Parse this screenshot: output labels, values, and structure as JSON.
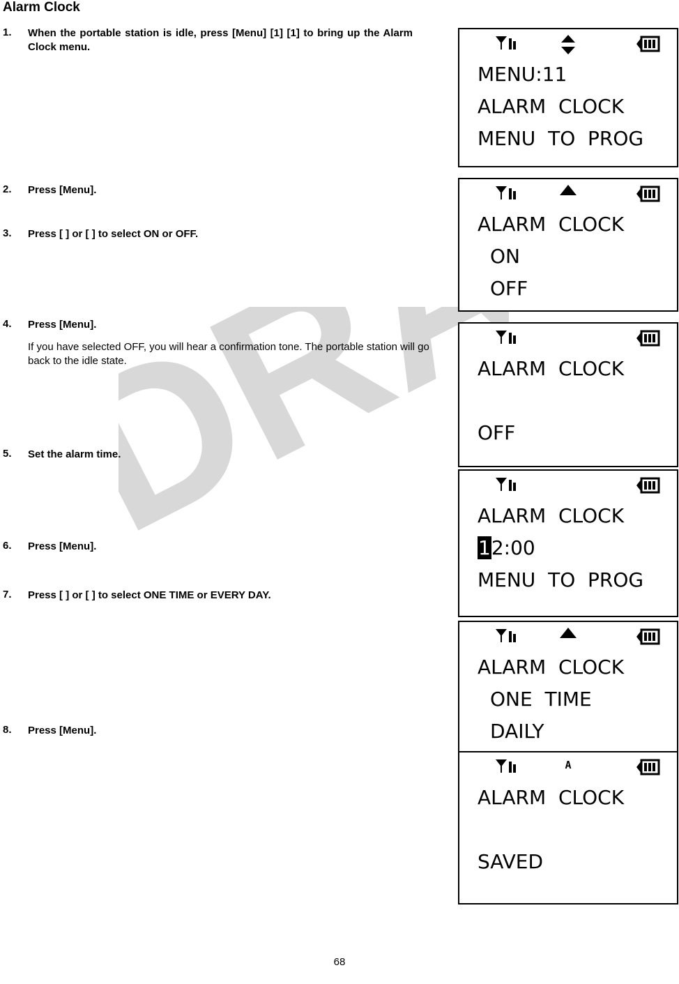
{
  "page": {
    "title": "Alarm Clock",
    "number": "68",
    "watermark": "DRAFT"
  },
  "steps": [
    {
      "num": "1.",
      "text": "When the portable station is idle, press [Menu] [1] [1] to bring up the Alarm Clock menu.",
      "note": ""
    },
    {
      "num": "2.",
      "text": "Press [Menu].",
      "note": ""
    },
    {
      "num": "3.",
      "text": "Press [   ] or [   ] to select ON or OFF.",
      "note": ""
    },
    {
      "num": "4.",
      "text": "Press [Menu].",
      "note": "If you have selected OFF, you will hear a confirmation tone. The portable station will go back to the idle state."
    },
    {
      "num": "5.",
      "text": "Set the alarm time.",
      "note": ""
    },
    {
      "num": "6.",
      "text": "Press [Menu].",
      "note": ""
    },
    {
      "num": "7.",
      "text": "Press [   ] or [   ] to select ONE TIME  or EVERY DAY.",
      "note": ""
    },
    {
      "num": "8.",
      "text": "Press [Menu].",
      "note": ""
    }
  ],
  "screens": [
    {
      "icons": {
        "left": "signal-icon",
        "middle": "up-down-arrow-icon",
        "right": "battery-icon"
      },
      "lines": [
        {
          "text": "MENU:11",
          "indent": false,
          "highlight": ""
        },
        {
          "text": "ALARM  CLOCK",
          "indent": false,
          "highlight": ""
        },
        {
          "text": "MENU  TO  PROG",
          "indent": false,
          "highlight": ""
        }
      ]
    },
    {
      "icons": {
        "left": "signal-icon",
        "middle": "up-arrow-icon",
        "right": "battery-icon"
      },
      "lines": [
        {
          "text": "ALARM  CLOCK",
          "indent": false,
          "highlight": ""
        },
        {
          "text": "ON",
          "indent": true,
          "highlight": ""
        },
        {
          "text": "OFF",
          "indent": true,
          "highlight": ""
        }
      ]
    },
    {
      "icons": {
        "left": "signal-icon",
        "middle": "",
        "right": "battery-icon"
      },
      "lines": [
        {
          "text": "ALARM  CLOCK",
          "indent": false,
          "highlight": ""
        },
        {
          "text": "",
          "indent": false,
          "highlight": ""
        },
        {
          "text": "OFF",
          "indent": false,
          "highlight": ""
        }
      ]
    },
    {
      "icons": {
        "left": "signal-icon",
        "middle": "",
        "right": "battery-icon"
      },
      "lines": [
        {
          "text": "ALARM  CLOCK",
          "indent": false,
          "highlight": ""
        },
        {
          "text": "2:00",
          "indent": false,
          "highlight": "1"
        },
        {
          "text": "MENU  TO  PROG",
          "indent": false,
          "highlight": ""
        }
      ]
    },
    {
      "icons": {
        "left": "signal-icon",
        "middle": "up-arrow-icon",
        "right": "battery-icon"
      },
      "lines": [
        {
          "text": "ALARM  CLOCK",
          "indent": false,
          "highlight": ""
        },
        {
          "text": "ONE  TIME",
          "indent": true,
          "highlight": ""
        },
        {
          "text": "DAILY",
          "indent": true,
          "highlight": ""
        }
      ]
    },
    {
      "icons": {
        "left": "signal-icon",
        "middle": "alarm-a-icon",
        "right": "battery-icon"
      },
      "lines": [
        {
          "text": "ALARM  CLOCK",
          "indent": false,
          "highlight": ""
        },
        {
          "text": "",
          "indent": false,
          "highlight": ""
        },
        {
          "text": "SAVED",
          "indent": false,
          "highlight": ""
        }
      ]
    }
  ]
}
